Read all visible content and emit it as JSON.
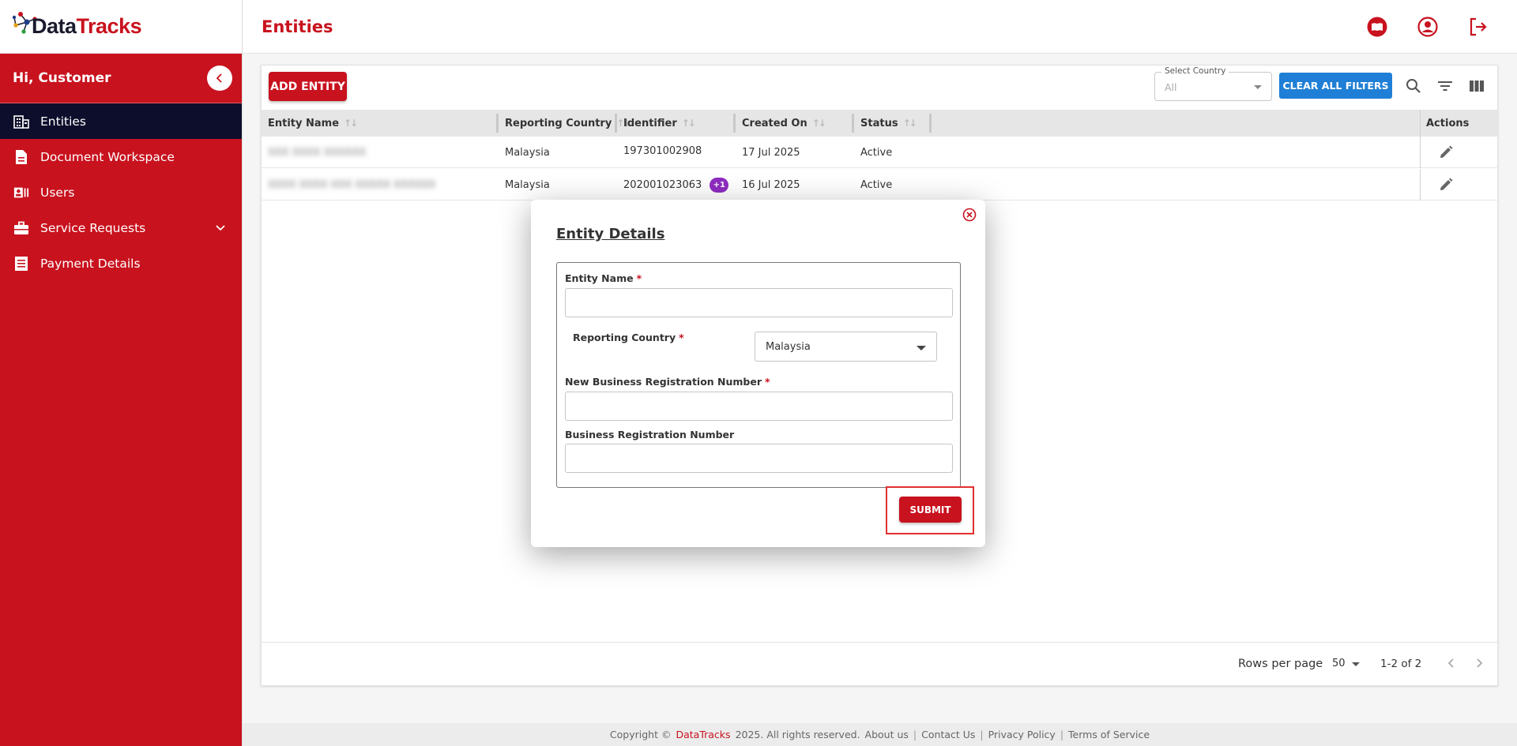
{
  "brand": {
    "name_part1": "Data",
    "name_part2": "Tracks"
  },
  "sidebar": {
    "greeting": "Hi, Customer",
    "items": [
      {
        "label": "Entities",
        "icon": "building-icon",
        "active": true
      },
      {
        "label": "Document Workspace",
        "icon": "document-icon"
      },
      {
        "label": "Users",
        "icon": "user-card-icon"
      },
      {
        "label": "Service Requests",
        "icon": "briefcase-icon",
        "expandable": true
      },
      {
        "label": "Payment Details",
        "icon": "receipt-icon"
      }
    ]
  },
  "header": {
    "title": "Entities"
  },
  "toolbar": {
    "add_label": "ADD ENTITY",
    "country_filter_label": "Select Country",
    "country_filter_value": "All",
    "clear_label": "CLEAR ALL FILTERS"
  },
  "table": {
    "columns": [
      "Entity Name",
      "Reporting Country",
      "Identifier",
      "Created On",
      "Status",
      "Actions"
    ],
    "rows": [
      {
        "entity_name": "XXX XXXX XXXXXX",
        "country": "Malaysia",
        "identifier": "197301002908",
        "extra": "",
        "created": "17 Jul 2025",
        "status": "Active"
      },
      {
        "entity_name": "XXXX XXXX XXX XXXXX XXXXXX",
        "country": "Malaysia",
        "identifier": "202001023063",
        "extra": "+1",
        "created": "16 Jul 2025",
        "status": "Active"
      }
    ]
  },
  "pagination": {
    "rows_label": "Rows per page",
    "rows_value": "50",
    "range": "1-2 of 2"
  },
  "footer": {
    "copyright": "Copyright ©",
    "brand": "DataTracks",
    "rights": "2025. All rights reserved.",
    "links": [
      "About us",
      "Contact Us",
      "Privacy Policy",
      "Terms of Service"
    ]
  },
  "modal": {
    "title": "Entity Details",
    "fields": {
      "entity_name": {
        "label": "Entity Name",
        "required": "*",
        "value": ""
      },
      "reporting_country": {
        "label": "Reporting Country",
        "required": "*",
        "value": "Malaysia"
      },
      "new_brn": {
        "label": "New Business Registration Number",
        "required": "*",
        "value": ""
      },
      "brn": {
        "label": "Business Registration Number",
        "value": ""
      }
    },
    "submit_label": "SUBMIT"
  },
  "colors": {
    "brand_red": "#c8121e",
    "nav_active": "#0d0e2b",
    "accent_blue": "#1f7fd6",
    "badge_purple": "#8e2cc1"
  }
}
